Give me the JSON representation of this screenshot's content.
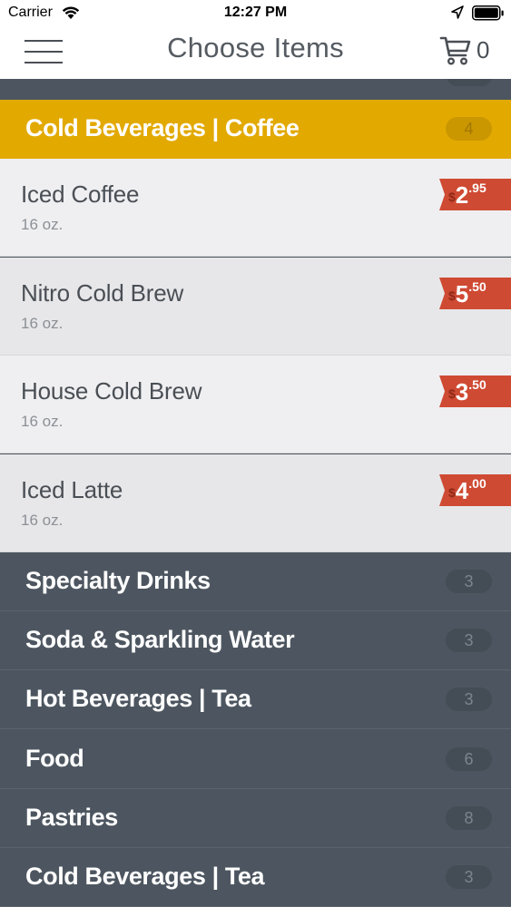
{
  "status_bar": {
    "carrier": "Carrier",
    "time": "12:27 PM"
  },
  "nav": {
    "title": "Choose Items",
    "cart_count": "0"
  },
  "open_category": {
    "label": "Cold Beverages | Coffee",
    "count": "4"
  },
  "items": [
    {
      "name": "Iced Coffee",
      "size": "16 oz.",
      "currency": "$",
      "dollars": "2",
      "cents": ".95"
    },
    {
      "name": "Nitro Cold Brew",
      "size": "16 oz.",
      "currency": "$",
      "dollars": "5",
      "cents": ".50"
    },
    {
      "name": "House Cold Brew",
      "size": "16 oz.",
      "currency": "$",
      "dollars": "3",
      "cents": ".50"
    },
    {
      "name": "Iced Latte",
      "size": "16 oz.",
      "currency": "$",
      "dollars": "4",
      "cents": ".00"
    }
  ],
  "categories": [
    {
      "label": "Specialty Drinks",
      "count": "3"
    },
    {
      "label": "Soda & Sparkling Water",
      "count": "3"
    },
    {
      "label": "Hot Beverages | Tea",
      "count": "3"
    },
    {
      "label": "Food",
      "count": "6"
    },
    {
      "label": "Pastries",
      "count": "8"
    },
    {
      "label": "Cold Beverages | Tea",
      "count": "3"
    }
  ],
  "colors": {
    "accent": "#e2a900",
    "price_tag": "#cf4a33",
    "category_bg": "#4d5660"
  }
}
